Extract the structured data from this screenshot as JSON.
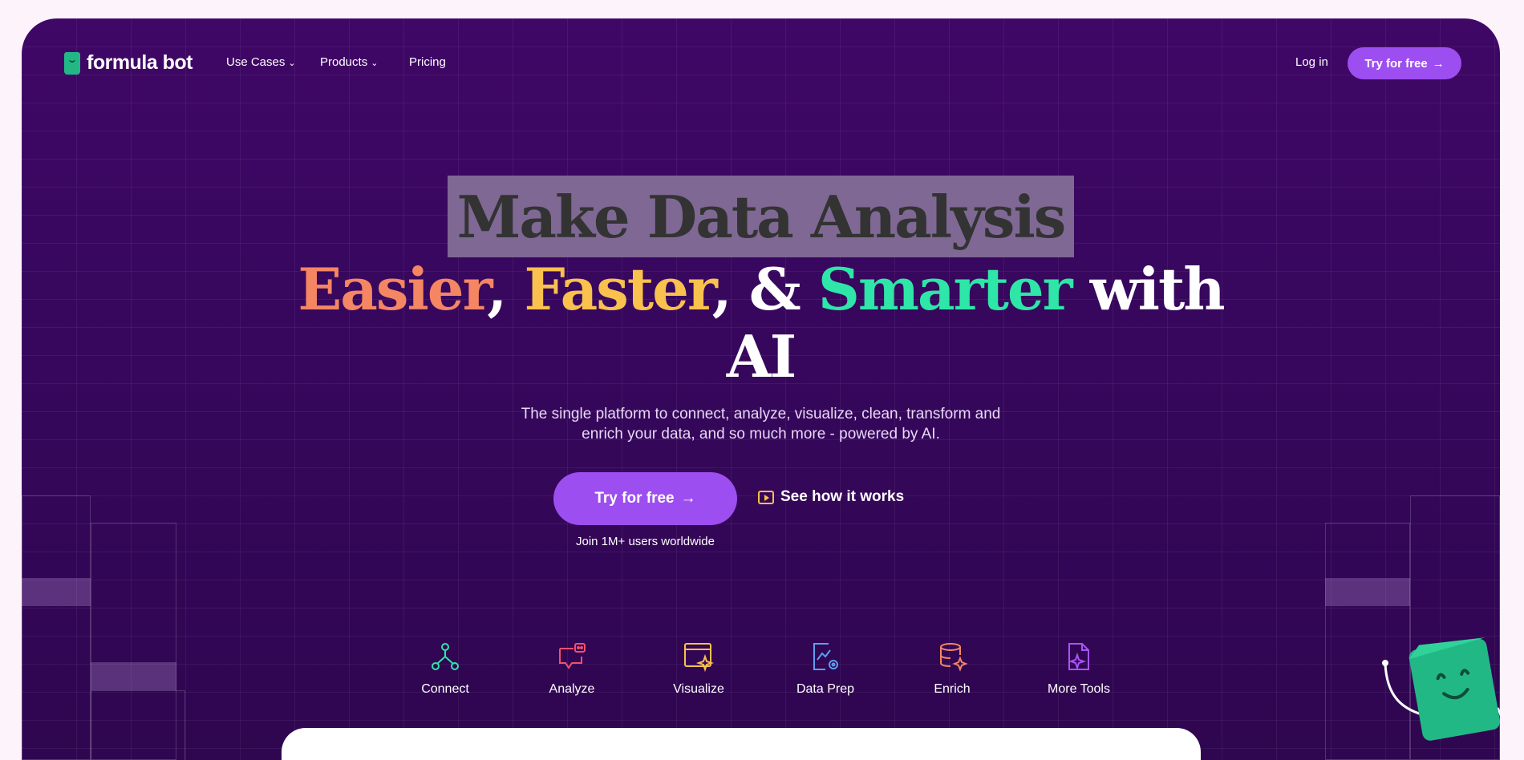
{
  "brand": {
    "name": "formula bot"
  },
  "nav": {
    "use_cases": "Use Cases",
    "products": "Products",
    "pricing": "Pricing",
    "login": "Log in",
    "cta": "Try for free"
  },
  "hero": {
    "line1": "Make Data Analysis",
    "easier": "Easier",
    "comma1": ",",
    "faster": "Faster",
    "comma2": ",",
    "amp": "&",
    "smarter": "Smarter",
    "with": "with",
    "ai": "AI",
    "subtitle_line1": "The single platform to connect, analyze, visualize, clean, transform and",
    "subtitle_line2": "enrich your data, and so much more - powered by AI.",
    "cta_primary": "Try for free",
    "cta_secondary": "See how it works",
    "join": "Join 1M+ users worldwide"
  },
  "tabs": [
    {
      "label": "Connect",
      "icon": "connect-icon",
      "color": "#2ee6a7",
      "active": true
    },
    {
      "label": "Analyze",
      "icon": "chat-bot-icon",
      "color": "#f0506e",
      "active": false
    },
    {
      "label": "Visualize",
      "icon": "browser-sparkle-icon",
      "color": "#f9c14d",
      "active": false
    },
    {
      "label": "Data Prep",
      "icon": "chart-gear-icon",
      "color": "#5aa0f0",
      "active": false
    },
    {
      "label": "Enrich",
      "icon": "database-sparkle-icon",
      "color": "#f48663",
      "active": false
    },
    {
      "label": "More Tools",
      "icon": "file-sparkle-icon",
      "color": "#a855f7",
      "active": false
    }
  ],
  "colors": {
    "accent": "#9d4ef0",
    "background": "#3f0766",
    "easier": "#f48663",
    "faster": "#f9c14d",
    "smarter": "#2ee6a7",
    "mascot": "#22b886"
  }
}
